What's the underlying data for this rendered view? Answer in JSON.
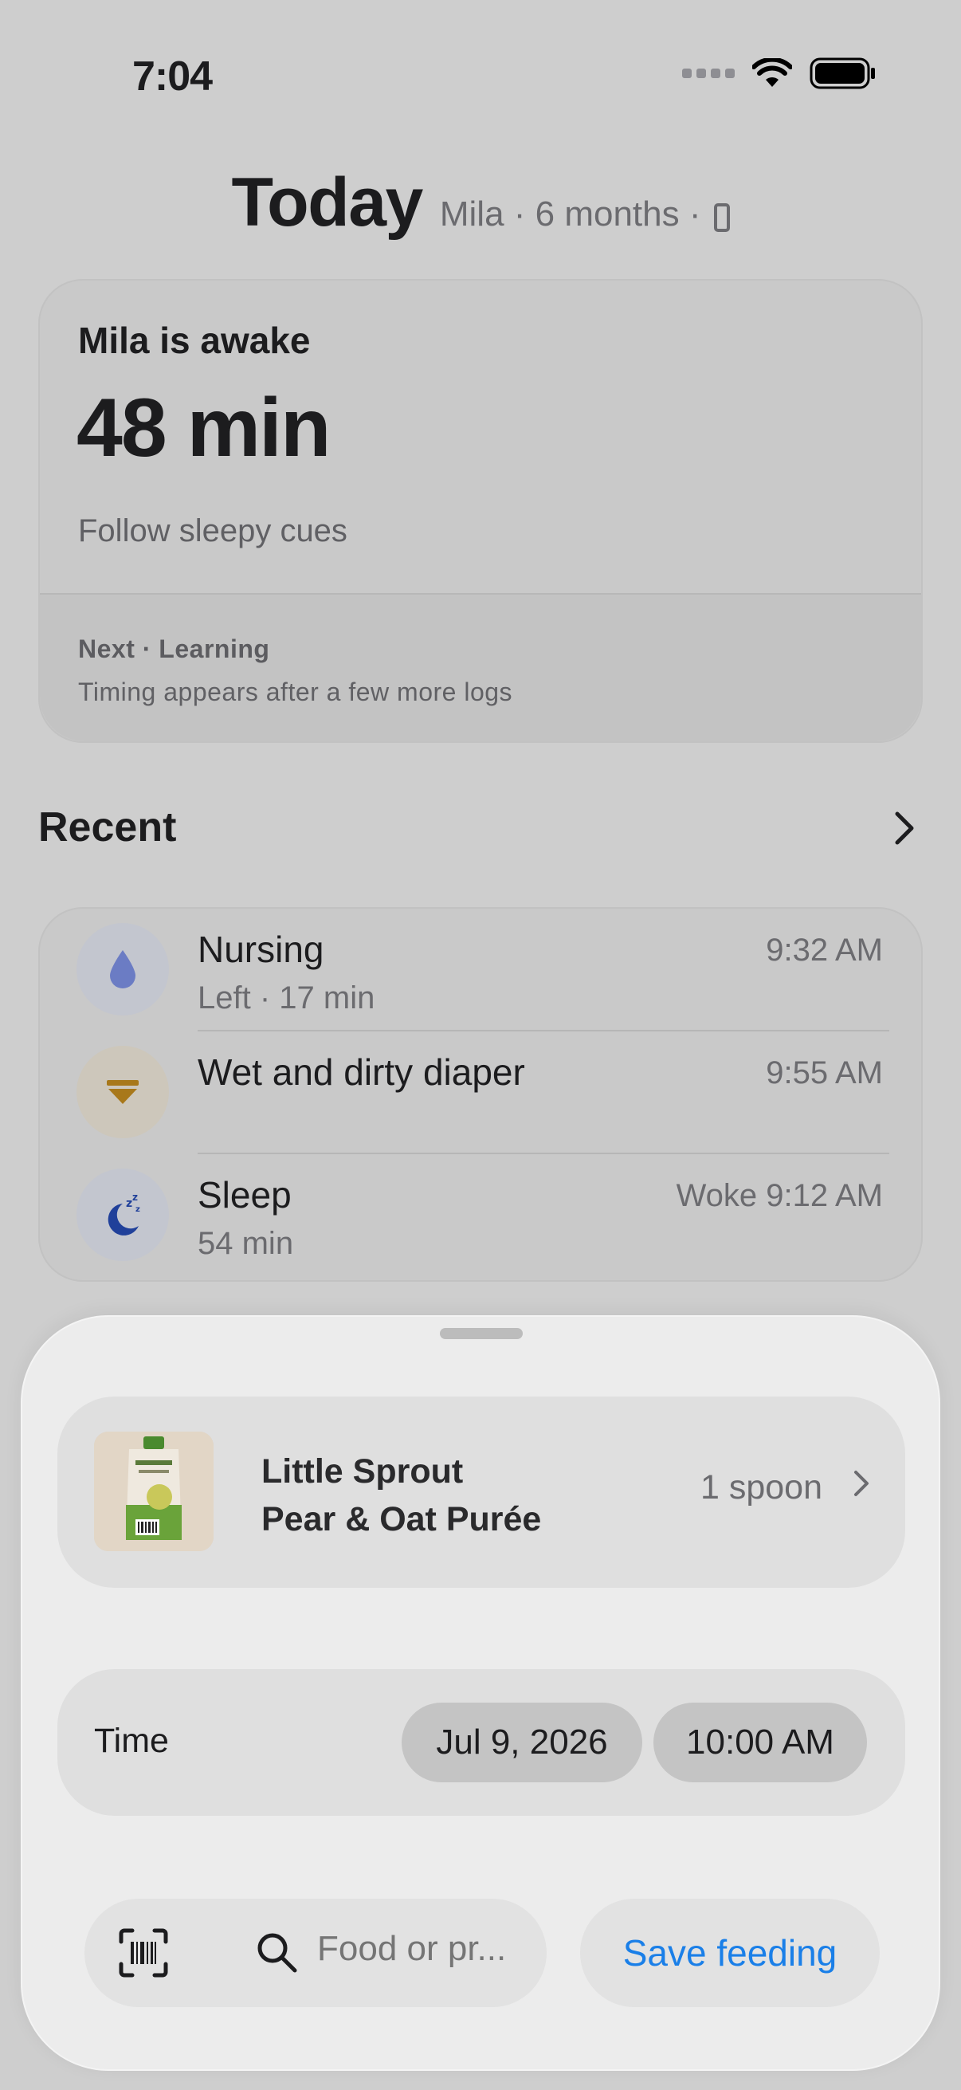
{
  "status_bar": {
    "time": "7:04"
  },
  "header": {
    "title": "Today",
    "subtitle": "Mila · 6 months ·"
  },
  "awake_card": {
    "title": "Mila is awake",
    "value": "48 min",
    "hint": "Follow sleepy cues",
    "next_label": "Next · Learning",
    "next_desc": "Timing appears after a few more logs"
  },
  "recent": {
    "title": "Recent",
    "items": [
      {
        "title": "Nursing",
        "subtitle": "Left · 17 min",
        "time": "9:32 AM",
        "icon": "drop-icon",
        "icon_bg": "#c3c6cf",
        "icon_color": "#6b7cc4"
      },
      {
        "title": "Wet and dirty diaper",
        "subtitle": "",
        "time": "9:55 AM",
        "icon": "diaper-icon",
        "icon_bg": "#cdc7bb",
        "icon_color": "#a8781a"
      },
      {
        "title": "Sleep",
        "subtitle": "54 min",
        "time": "Woke 9:12 AM",
        "icon": "moon-icon",
        "icon_bg": "#c3c6cf",
        "icon_color": "#20409a"
      }
    ]
  },
  "sheet": {
    "food": {
      "name_line1": "Little Sprout",
      "name_line2": "Pear & Oat Purée",
      "quantity": "1 spoon"
    },
    "time": {
      "label": "Time",
      "date": "Jul 9, 2026",
      "time": "10:00 AM"
    },
    "search": {
      "placeholder": "Food or pr..."
    },
    "save_label": "Save feeding",
    "accent": "#1a7fe8"
  }
}
